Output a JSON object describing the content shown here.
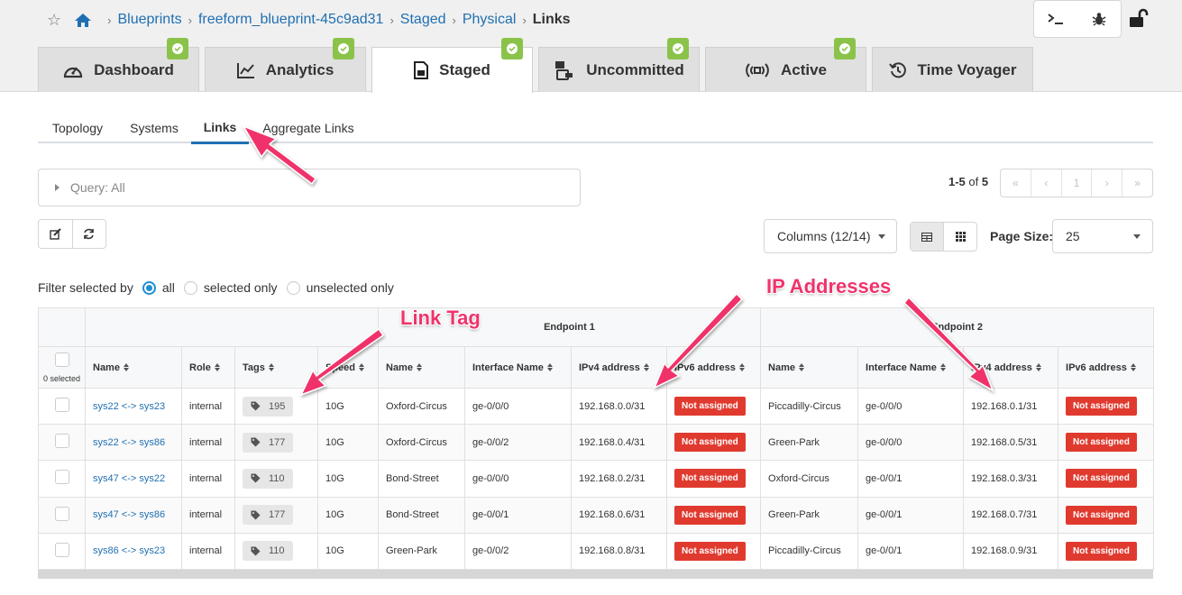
{
  "breadcrumb": {
    "items": [
      "Blueprints",
      "freeform_blueprint-45c9ad31",
      "Staged",
      "Physical"
    ],
    "current": "Links"
  },
  "tabs": [
    {
      "label": "Dashboard",
      "icon": "dashboard-icon",
      "check": true
    },
    {
      "label": "Analytics",
      "icon": "chart-icon",
      "check": true
    },
    {
      "label": "Staged",
      "icon": "document-icon",
      "check": true,
      "active": true
    },
    {
      "label": "Uncommitted",
      "icon": "uncommitted-icon",
      "check": true
    },
    {
      "label": "Active",
      "icon": "broadcast-icon",
      "check": true
    },
    {
      "label": "Time Voyager",
      "icon": "history-icon",
      "check": false
    }
  ],
  "subtabs": [
    "Topology",
    "Systems",
    "Links",
    "Aggregate Links"
  ],
  "active_subtab": "Links",
  "query": {
    "label": "Query: All"
  },
  "pagination": {
    "range": "1-5",
    "of": "of",
    "total": "5",
    "current_page": "1",
    "first": "«",
    "prev": "‹",
    "next": "›",
    "last": "»"
  },
  "columns_button": "Columns (12/14)",
  "page_size": {
    "label": "Page Size:",
    "value": "25"
  },
  "filter": {
    "label": "Filter selected by",
    "options": [
      "all",
      "selected only",
      "unselected only"
    ],
    "selected": "all"
  },
  "table": {
    "groups": {
      "endpoint1": "Endpoint 1",
      "endpoint2": "Endpoint 2"
    },
    "selected_count": "0 selected",
    "headers": [
      "Name",
      "Role",
      "Tags",
      "Speed",
      "Name",
      "Interface Name",
      "IPv4 address",
      "IPv6 address",
      "Name",
      "Interface Name",
      "IPv4 address",
      "IPv6 address"
    ],
    "rows": [
      {
        "name": "sys22 <-> sys23",
        "role": "internal",
        "tags": "195",
        "speed": "10G",
        "ep1_name": "Oxford-Circus",
        "ep1_if": "ge-0/0/0",
        "ep1_ipv4": "192.168.0.0/31",
        "ep1_ipv6": "Not assigned",
        "ep2_name": "Piccadilly-Circus",
        "ep2_if": "ge-0/0/0",
        "ep2_ipv4": "192.168.0.1/31",
        "ep2_ipv6": "Not assigned"
      },
      {
        "name": "sys22 <-> sys86",
        "role": "internal",
        "tags": "177",
        "speed": "10G",
        "ep1_name": "Oxford-Circus",
        "ep1_if": "ge-0/0/2",
        "ep1_ipv4": "192.168.0.4/31",
        "ep1_ipv6": "Not assigned",
        "ep2_name": "Green-Park",
        "ep2_if": "ge-0/0/0",
        "ep2_ipv4": "192.168.0.5/31",
        "ep2_ipv6": "Not assigned"
      },
      {
        "name": "sys47 <-> sys22",
        "role": "internal",
        "tags": "110",
        "speed": "10G",
        "ep1_name": "Bond-Street",
        "ep1_if": "ge-0/0/0",
        "ep1_ipv4": "192.168.0.2/31",
        "ep1_ipv6": "Not assigned",
        "ep2_name": "Oxford-Circus",
        "ep2_if": "ge-0/0/1",
        "ep2_ipv4": "192.168.0.3/31",
        "ep2_ipv6": "Not assigned"
      },
      {
        "name": "sys47 <-> sys86",
        "role": "internal",
        "tags": "177",
        "speed": "10G",
        "ep1_name": "Bond-Street",
        "ep1_if": "ge-0/0/1",
        "ep1_ipv4": "192.168.0.6/31",
        "ep1_ipv6": "Not assigned",
        "ep2_name": "Green-Park",
        "ep2_if": "ge-0/0/1",
        "ep2_ipv4": "192.168.0.7/31",
        "ep2_ipv6": "Not assigned"
      },
      {
        "name": "sys86 <-> sys23",
        "role": "internal",
        "tags": "110",
        "speed": "10G",
        "ep1_name": "Green-Park",
        "ep1_if": "ge-0/0/2",
        "ep1_ipv4": "192.168.0.8/31",
        "ep1_ipv6": "Not assigned",
        "ep2_name": "Piccadilly-Circus",
        "ep2_if": "ge-0/0/1",
        "ep2_ipv4": "192.168.0.9/31",
        "ep2_ipv6": "Not assigned"
      }
    ]
  },
  "annotations": {
    "link_tag": "Link Tag",
    "ip_addresses": "IP Addresses"
  },
  "colors": {
    "accent": "#1f6fb2",
    "check": "#8bc34a",
    "badge": "#e03a2f",
    "annotation": "#f0336b"
  }
}
